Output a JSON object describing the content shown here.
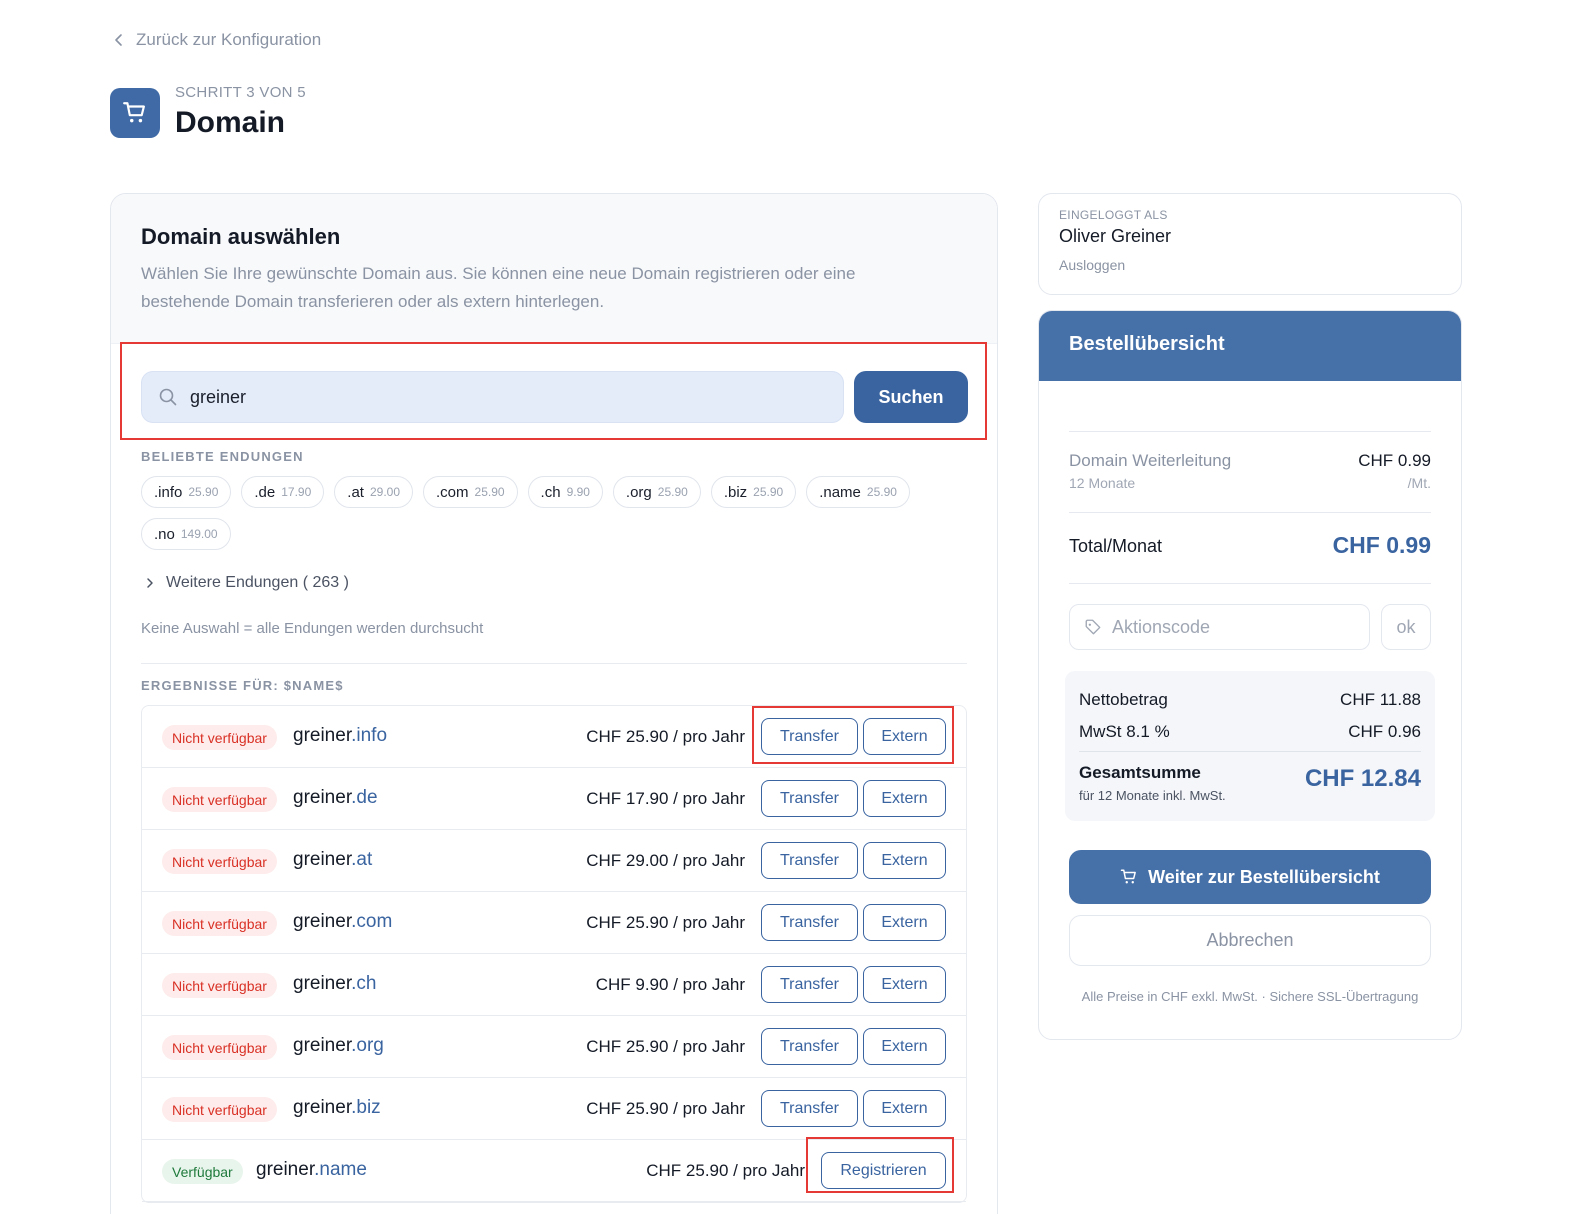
{
  "back_link": "Zurück zur Konfiguration",
  "header": {
    "step": "SCHRITT 3 VON 5",
    "title": "Domain"
  },
  "main": {
    "title": "Domain auswählen",
    "description": "Wählen Sie Ihre gewünschte Domain aus. Sie können eine neue Domain registrieren oder eine bestehende Domain transferieren oder als extern hinterlegen.",
    "search": {
      "value": "greiner",
      "button": "Suchen"
    },
    "popular_label": "BELIEBTE ENDUNGEN",
    "popular": [
      {
        "ext": ".info",
        "price": "25.90"
      },
      {
        "ext": ".de",
        "price": "17.90"
      },
      {
        "ext": ".at",
        "price": "29.00"
      },
      {
        "ext": ".com",
        "price": "25.90"
      },
      {
        "ext": ".ch",
        "price": "9.90"
      },
      {
        "ext": ".org",
        "price": "25.90"
      },
      {
        "ext": ".biz",
        "price": "25.90"
      },
      {
        "ext": ".name",
        "price": "25.90"
      },
      {
        "ext": ".no",
        "price": "149.00"
      }
    ],
    "more_endings": "Weitere Endungen ( 263 )",
    "hint": "Keine Auswahl = alle Endungen werden durchsucht",
    "results_label": "ERGEBNISSE FÜR: $NAME$",
    "results": [
      {
        "status": "Nicht verfügbar",
        "available": false,
        "name": "greiner",
        "tld": ".info",
        "price": "CHF 25.90 / pro Jahr",
        "actions": [
          "Transfer",
          "Extern"
        ]
      },
      {
        "status": "Nicht verfügbar",
        "available": false,
        "name": "greiner",
        "tld": ".de",
        "price": "CHF 17.90 / pro Jahr",
        "actions": [
          "Transfer",
          "Extern"
        ]
      },
      {
        "status": "Nicht verfügbar",
        "available": false,
        "name": "greiner",
        "tld": ".at",
        "price": "CHF 29.00 / pro Jahr",
        "actions": [
          "Transfer",
          "Extern"
        ]
      },
      {
        "status": "Nicht verfügbar",
        "available": false,
        "name": "greiner",
        "tld": ".com",
        "price": "CHF 25.90 / pro Jahr",
        "actions": [
          "Transfer",
          "Extern"
        ]
      },
      {
        "status": "Nicht verfügbar",
        "available": false,
        "name": "greiner",
        "tld": ".ch",
        "price": "CHF 9.90 / pro Jahr",
        "actions": [
          "Transfer",
          "Extern"
        ]
      },
      {
        "status": "Nicht verfügbar",
        "available": false,
        "name": "greiner",
        "tld": ".org",
        "price": "CHF 25.90 / pro Jahr",
        "actions": [
          "Transfer",
          "Extern"
        ]
      },
      {
        "status": "Nicht verfügbar",
        "available": false,
        "name": "greiner",
        "tld": ".biz",
        "price": "CHF 25.90 / pro Jahr",
        "actions": [
          "Transfer",
          "Extern"
        ]
      },
      {
        "status": "Verfügbar",
        "available": true,
        "name": "greiner",
        "tld": ".name",
        "price": "CHF 25.90 / pro Jahr",
        "actions": [
          "Registrieren"
        ]
      }
    ]
  },
  "user": {
    "label": "EINGELOGGT ALS",
    "name": "Oliver Greiner",
    "logout": "Ausloggen"
  },
  "order": {
    "title": "Bestellübersicht",
    "item": {
      "name": "Domain Weiterleitung",
      "sub": "12 Monate",
      "price": "CHF 0.99",
      "unit": "/Mt."
    },
    "total_label": "Total/Monat",
    "total_value": "CHF 0.99",
    "promo_placeholder": "Aktionscode",
    "promo_ok": "ok",
    "net_label": "Nettobetrag",
    "net_value": "CHF 11.88",
    "vat_label": "MwSt 8.1 %",
    "vat_value": "CHF 0.96",
    "grand_label": "Gesamtsumme",
    "grand_sub": "für 12 Monate inkl. MwSt.",
    "grand_value": "CHF 12.84",
    "continue": "Weiter zur Bestellübersicht",
    "cancel": "Abbrechen",
    "footnote": "Alle Preise in CHF exkl. MwSt. · Sichere SSL-Übertragung"
  },
  "colors": {
    "accent": "#3a64a0",
    "unavailable": "#d93025",
    "available": "#1f7a3c",
    "highlight": "#e53935"
  }
}
